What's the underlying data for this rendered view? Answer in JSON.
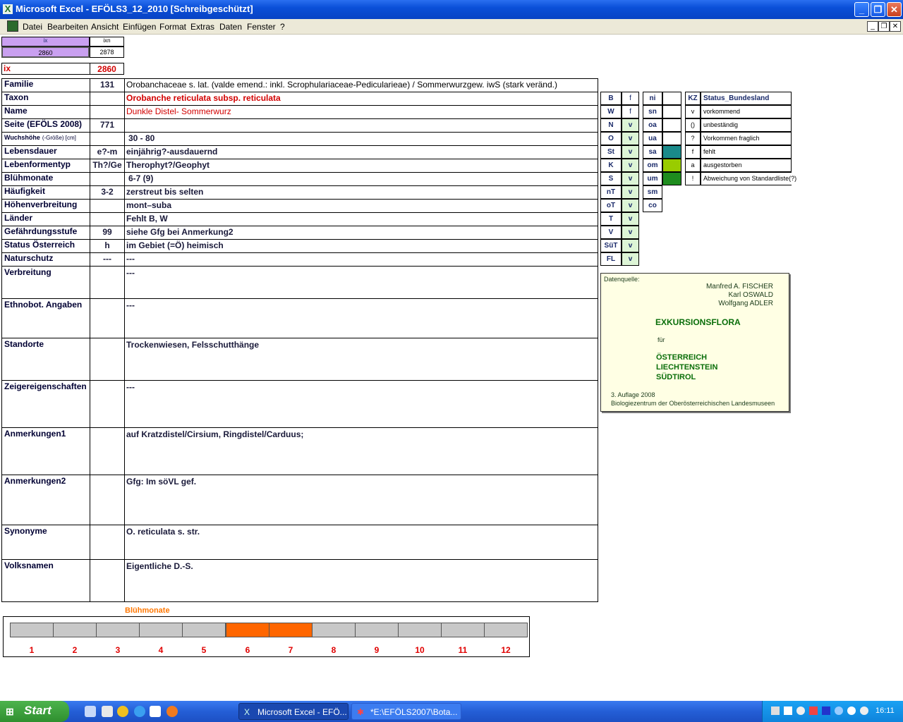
{
  "window": {
    "title": "Microsoft Excel - EFÖLS3_12_2010  [Schreibgeschützt]",
    "icon": "excel-icon"
  },
  "menu": {
    "items": [
      "Datei",
      "Bearbeiten",
      "Ansicht",
      "Einfügen",
      "Format",
      "Extras",
      "Daten",
      "Fenster",
      "?"
    ]
  },
  "top": {
    "ix_header": "ix",
    "ixn_header": "ixn",
    "ix_value": "2860",
    "ixn_value": "2878",
    "ix_label": "ix",
    "ix_big": "2860"
  },
  "fields": [
    {
      "label": "Familie",
      "code": "131",
      "value": "Orobanchaceae s. lat. (valde emend.: inkl. Scrophulariaceae-Pedicularieae)  /  Sommerwurzgew. iwS (stark veränd.)"
    },
    {
      "label": "Taxon",
      "code": "",
      "value": "Orobanche reticulata subsp. reticulata"
    },
    {
      "label": "Name",
      "code": "",
      "value": "Dunkle Distel- Sommerwurz"
    },
    {
      "label": "Seite (EFÖLS 2008)",
      "code": "771",
      "value": ""
    },
    {
      "label": "Wuchshöhe",
      "label_suffix": "(-Größe) [cm]",
      "code": "",
      "value": "30 - 80"
    },
    {
      "label": "Lebensdauer",
      "code": "e?-m",
      "value": "einjährig?-ausdauernd"
    },
    {
      "label": "Lebenformentyp",
      "code": "Th?/Ge",
      "value": "Therophyt?/Geophyt"
    },
    {
      "label": "Blühmonate",
      "code": "",
      "value": "6-7 (9)"
    },
    {
      "label": "Häufigkeit",
      "code": "3-2",
      "value": "zerstreut bis selten"
    },
    {
      "label": "Höhenverbreitung",
      "code": "",
      "value": "mont–suba"
    },
    {
      "label": "Länder",
      "code": "",
      "value": "Fehlt B, W"
    },
    {
      "label": "Gefährdungsstufe",
      "code": "99",
      "value": "siehe Gfg bei Anmerkung2"
    },
    {
      "label": "Status Österreich",
      "code": "h",
      "value": "im Gebiet (=Ö) heimisch"
    },
    {
      "label": "Naturschutz",
      "code": "---",
      "value": "---"
    }
  ],
  "big_fields": [
    {
      "label": "Verbreitung",
      "value": "---"
    },
    {
      "label": "Ethnobot. Angaben",
      "value": "---"
    },
    {
      "label": "Standorte",
      "value": "Trockenwiesen, Felsschutthänge"
    },
    {
      "label": "Zeigereigenschaften",
      "value": "---"
    },
    {
      "label": "Anmerkungen1",
      "value": "auf Kratzdistel/Cirsium, Ringdistel/Carduus;"
    },
    {
      "label": "Anmerkungen2",
      "value": "Gfg: Im söVL gef."
    },
    {
      "label": "Synonyme",
      "value": "O. reticulata s. str."
    },
    {
      "label": "Volksnamen",
      "value": "Eigentliche D.-S."
    }
  ],
  "regions": {
    "header": [
      "B",
      "f"
    ],
    "rows": [
      [
        "W",
        "f"
      ],
      [
        "N",
        "v"
      ],
      [
        "O",
        "v"
      ],
      [
        "St",
        "v"
      ],
      [
        "K",
        "v"
      ],
      [
        "S",
        "v"
      ],
      [
        "nT",
        "v"
      ],
      [
        "oT",
        "v"
      ],
      [
        "T",
        "v"
      ],
      [
        "V",
        "v"
      ],
      [
        "SüT",
        "v"
      ],
      [
        "FL",
        "v"
      ]
    ]
  },
  "zones": {
    "rows": [
      "ni",
      "sn",
      "oa",
      "ua",
      "sa",
      "om",
      "um",
      "sm",
      "co"
    ],
    "swatches": {
      "sa": "#1a8a8a",
      "om": "#99cc00",
      "um": "#1e8c1e"
    }
  },
  "legend": {
    "header_kz": "KZ",
    "header_title": "Status_Bundesland",
    "rows": [
      [
        "v",
        "vorkommend"
      ],
      [
        "()",
        "unbeständig"
      ],
      [
        "?",
        "Vorkommen fraglich"
      ],
      [
        "f",
        "fehlt"
      ],
      [
        "a",
        "ausgestorben"
      ],
      [
        "!",
        "Abweichung von Standardliste(?)"
      ]
    ]
  },
  "source": {
    "heading": "Datenquelle:",
    "authors": [
      "Manfred A. FISCHER",
      "Karl OSWALD",
      "Wolfgang ADLER"
    ],
    "title": "EXKURSIONSFLORA",
    "fuer": "für",
    "countries": [
      "ÖSTERREICH",
      "LIECHTENSTEIN",
      "SÜDTIROL"
    ],
    "edition": "3. Auflage 2008",
    "publisher": "Biologiezentrum der Oberösterreichischen Landesmuseen"
  },
  "chart_data": {
    "type": "bar",
    "title": "Blühmonate",
    "categories": [
      "1",
      "2",
      "3",
      "4",
      "5",
      "6",
      "7",
      "8",
      "9",
      "10",
      "11",
      "12"
    ],
    "values": [
      0,
      0,
      0,
      0,
      0,
      1,
      1,
      0,
      0,
      0,
      0,
      0
    ],
    "colors": {
      "on": "#ff6600",
      "off": "#c8c8c8"
    }
  },
  "taskbar": {
    "start": "Start",
    "tasks": [
      "Microsoft Excel - EFÖ...",
      "*E:\\EFÖLS2007\\Bota..."
    ],
    "clock": "16:11"
  }
}
